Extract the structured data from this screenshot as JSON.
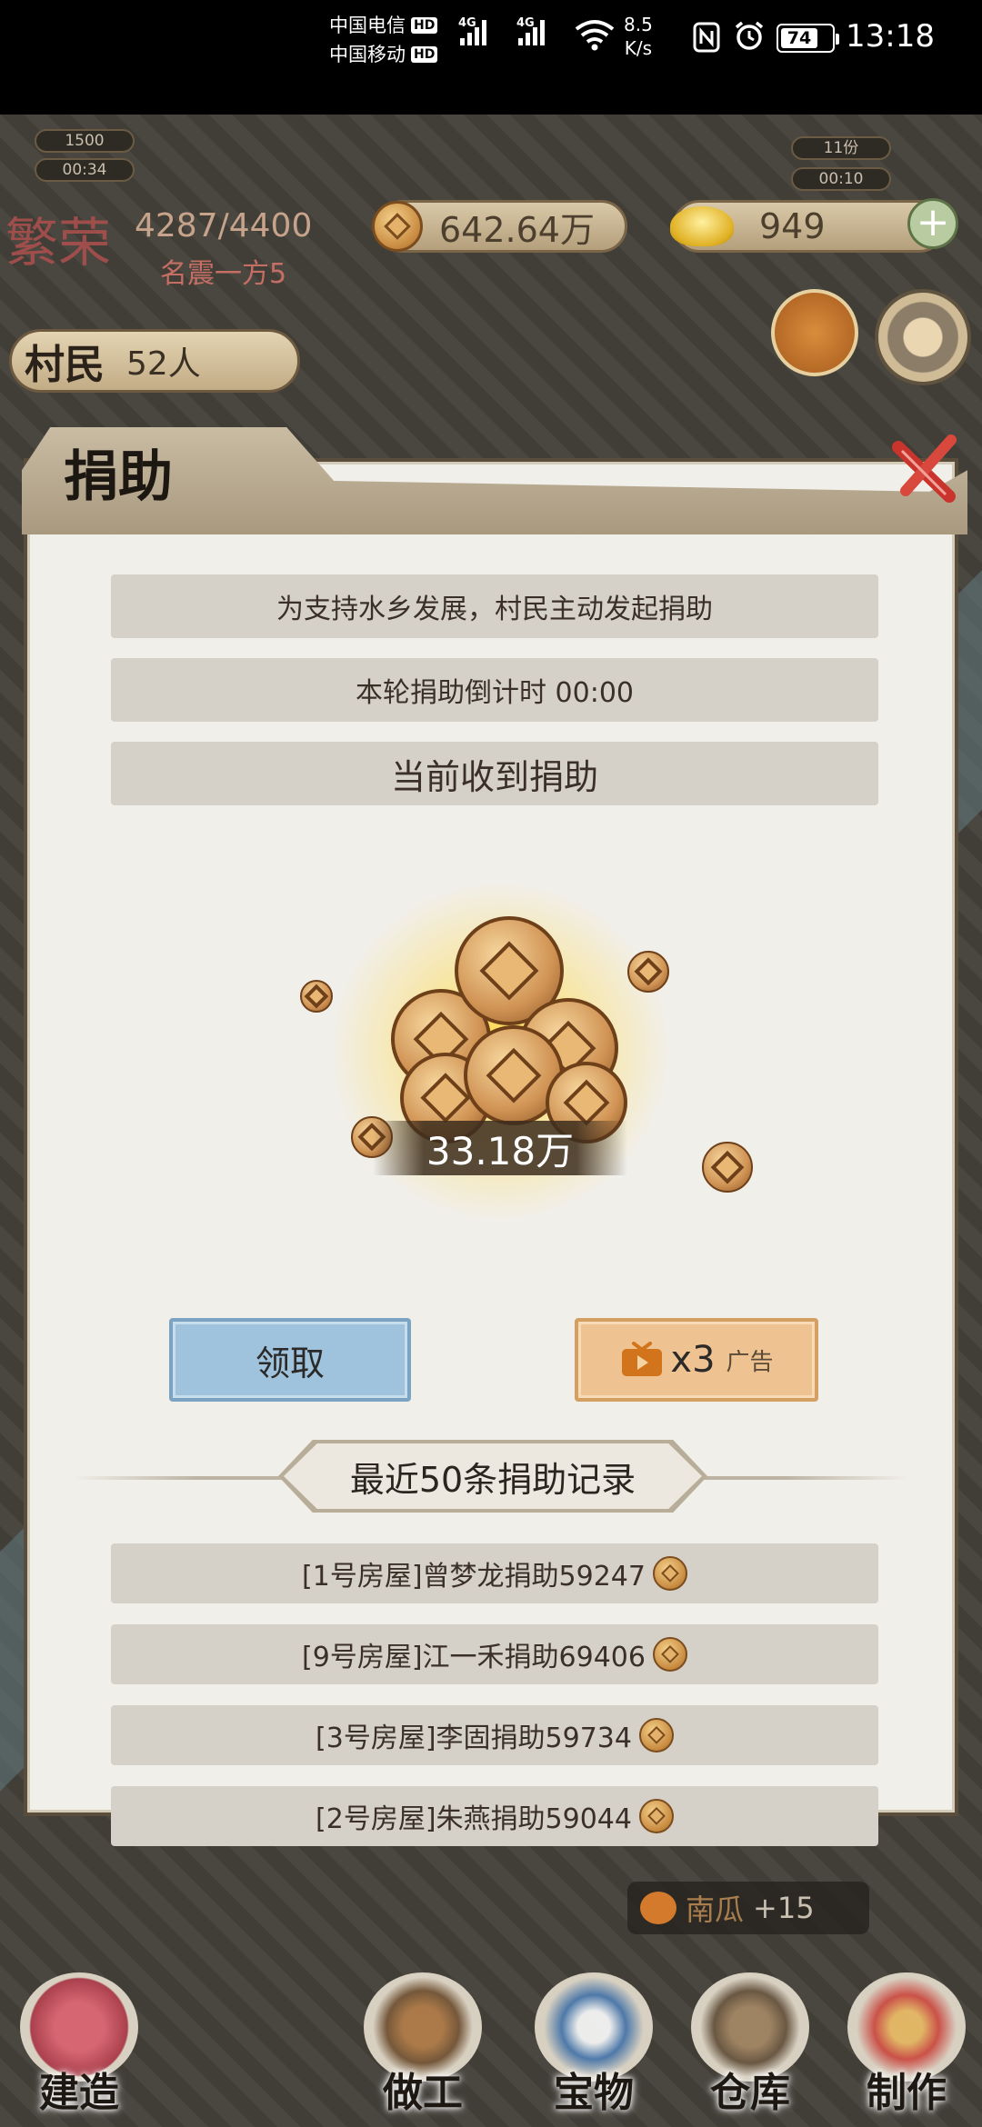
{
  "status_bar": {
    "carrier1": "中国电信",
    "carrier2": "中国移动",
    "hd": "HD",
    "network1": "4G",
    "network2": "4G",
    "speed_value": "8.5",
    "speed_unit": "K/s",
    "battery": "74",
    "time": "13:18"
  },
  "hud": {
    "timer_left_top": "1500",
    "timer_left_bottom": "00:34",
    "timer_right_top": "11份",
    "timer_right_bottom": "00:10",
    "prosperity_label": "繁荣",
    "prosperity_value": "4287/4400",
    "prosperity_title": "名震一方5",
    "copper_coins": "642.64万",
    "gold_ingots": "949",
    "villagers_label": "村民",
    "villagers_count": "52人"
  },
  "dialog": {
    "title": "捐助",
    "line1": "为支持水乡发展，村民主动发起捐助",
    "countdown": "本轮捐助倒计时 00:00",
    "current_label": "当前收到捐助",
    "amount": "33.18万",
    "claim_button": "领取",
    "ad_multiplier": "x3",
    "ad_label": "广告",
    "records_title": "最近50条捐助记录",
    "records": [
      {
        "text": "[1号房屋]曾梦龙捐助59247"
      },
      {
        "text": "[9号房屋]江一禾捐助69406"
      },
      {
        "text": "[3号房屋]李固捐助59734"
      },
      {
        "text": "[2号房屋]朱燕捐助59044"
      }
    ]
  },
  "toast": {
    "item": "南瓜",
    "amount": "+15"
  },
  "nav": {
    "build": "建造",
    "work": "做工",
    "treasure": "宝物",
    "warehouse": "仓库",
    "craft": "制作"
  }
}
